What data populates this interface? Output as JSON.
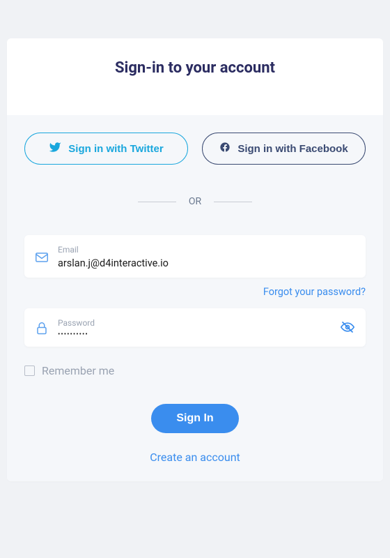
{
  "title": "Sign-in to your account",
  "social": {
    "twitter_label": "Sign in with Twitter",
    "facebook_label": "Sign in with Facebook"
  },
  "divider": "OR",
  "email": {
    "label": "Email",
    "value": "arslan.j@d4interactive.io"
  },
  "password": {
    "label": "Password",
    "value": "••••••••••"
  },
  "forgot_label": "Forgot your password?",
  "remember_label": "Remember me",
  "signin_label": "Sign In",
  "create_label": "Create an account"
}
